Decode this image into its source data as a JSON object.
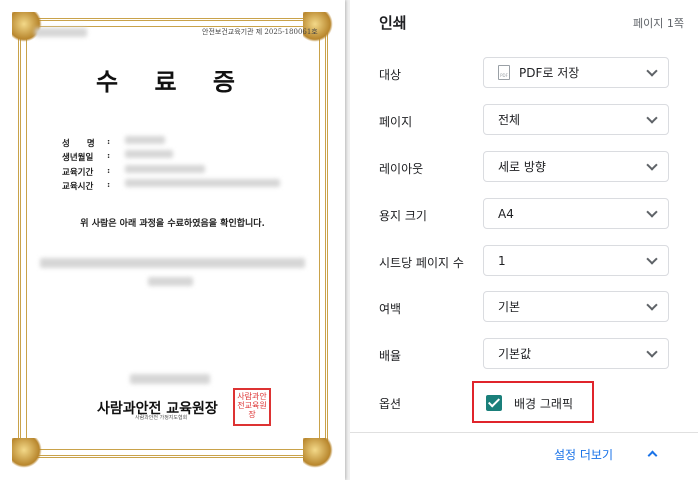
{
  "preview": {
    "serial": "안전보건교육기관 제 2025-180061호",
    "title": "수 료 증",
    "fields": [
      {
        "label": "성　　명"
      },
      {
        "label": "생년월일"
      },
      {
        "label": "교육기간"
      },
      {
        "label": "교육시간"
      }
    ],
    "statement": "위 사람은 아래 과정을 수료하였음을 확인합니다.",
    "issuer": "사람과안전 교육원장",
    "issuer_sub": "사람과안전 가정지도협회",
    "seal_text": "사람과안전교육원장"
  },
  "panel": {
    "title": "인쇄",
    "page_count": "페이지 1쪽",
    "settings": [
      {
        "label": "대상",
        "value": "PDF로 저장",
        "icon": "pdf-icon"
      },
      {
        "label": "페이지",
        "value": "전체"
      },
      {
        "label": "레이아웃",
        "value": "세로 방향"
      },
      {
        "label": "용지 크기",
        "value": "A4"
      },
      {
        "label": "시트당 페이지 수",
        "value": "1"
      },
      {
        "label": "여백",
        "value": "기본"
      },
      {
        "label": "배율",
        "value": "기본값"
      }
    ],
    "options_label": "옵션",
    "background_graphics": {
      "label": "배경 그래픽",
      "checked": true
    },
    "more_settings": "설정 더보기"
  },
  "colors": {
    "accent": "#1a73e8",
    "checkbox": "#1a7f7a",
    "highlight": "#e0242b",
    "frame_gold": "#c9a24a",
    "seal_red": "#dd3333"
  }
}
